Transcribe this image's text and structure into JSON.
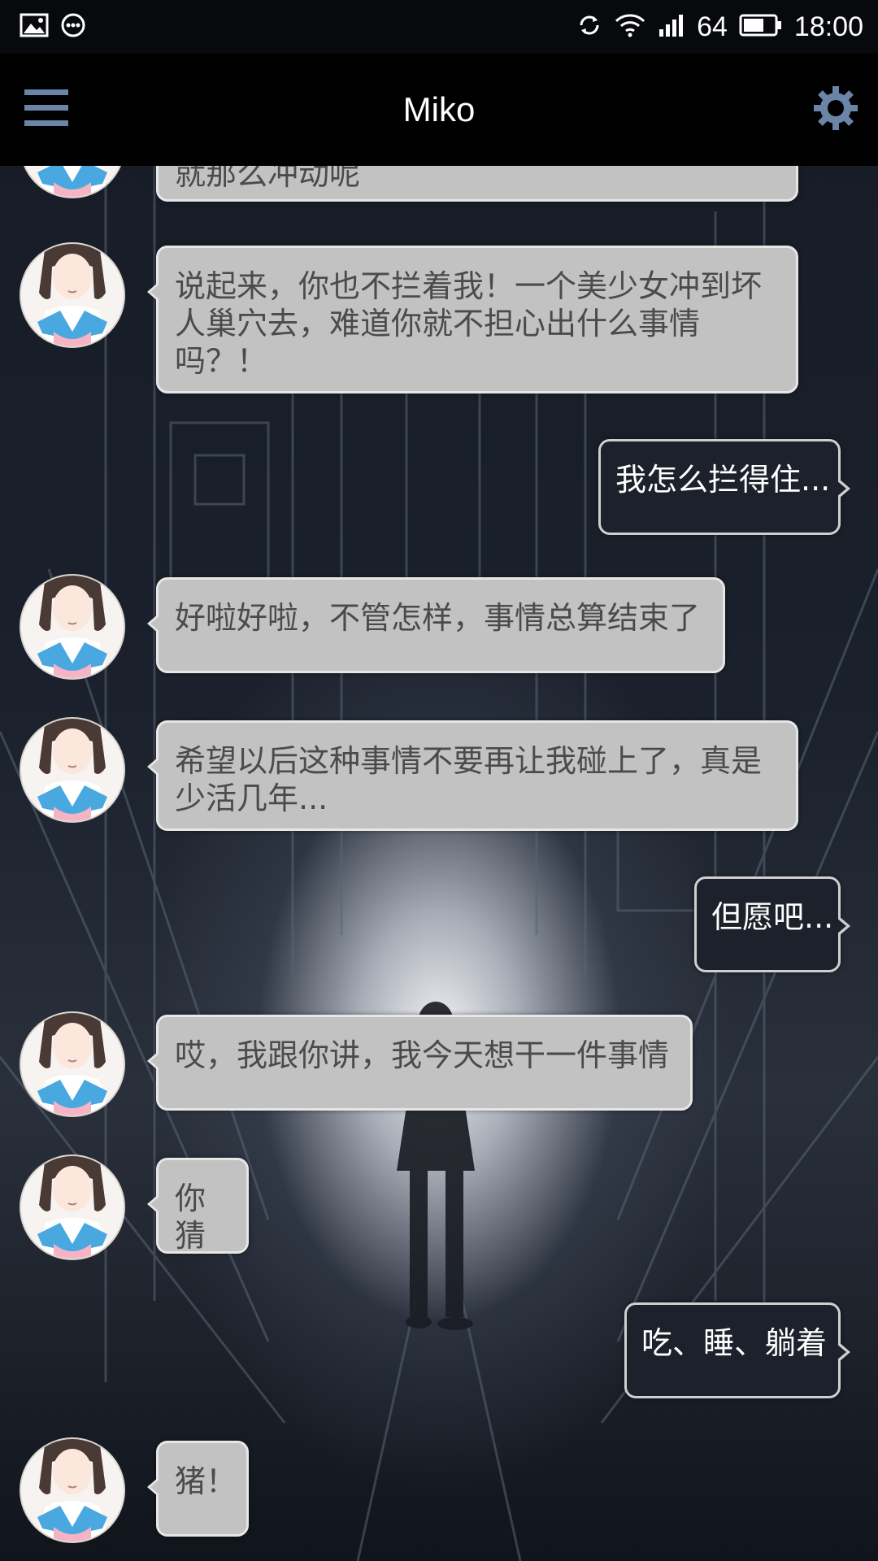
{
  "status_bar": {
    "left_icons": [
      "image-icon",
      "more-dots-icon"
    ],
    "right_icons": [
      "sync-icon",
      "wifi-icon",
      "signal-icon",
      "battery-icon"
    ],
    "signal_text": "64",
    "time": "18:00"
  },
  "app_bar": {
    "title": "Miko",
    "menu_icon": "hamburger-menu-icon",
    "settings_icon": "gear-icon"
  },
  "colors": {
    "incoming_bubble": "#c2c2c2",
    "outgoing_bubble": "#1c212b",
    "accent_icon": "#6b85a8"
  },
  "messages": [
    {
      "from": "miko",
      "text": "就那么冲动呢"
    },
    {
      "from": "miko",
      "text": "说起来，你也不拦着我！一个美少女冲到坏人巢穴去，难道你就不担心出什么事情吗？！"
    },
    {
      "from": "me",
      "text": "我怎么拦得住..."
    },
    {
      "from": "miko",
      "text": "好啦好啦，不管怎样，事情总算结束了"
    },
    {
      "from": "miko",
      "text": "希望以后这种事情不要再让我碰上了，真是少活几年..."
    },
    {
      "from": "me",
      "text": "但愿吧..."
    },
    {
      "from": "miko",
      "text": "哎，我跟你讲，我今天想干一件事情"
    },
    {
      "from": "miko",
      "text": "你猜"
    },
    {
      "from": "me",
      "text": "吃、睡、躺着"
    },
    {
      "from": "miko",
      "text": "猪！"
    }
  ]
}
